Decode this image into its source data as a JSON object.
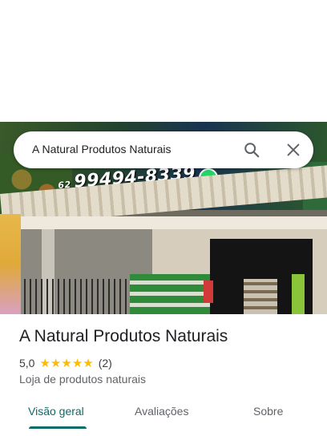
{
  "search": {
    "query": "A Natural Produtos Naturais",
    "search_icon": "search-icon",
    "close_icon": "close-icon"
  },
  "hero": {
    "banner_phone_prefix": "62",
    "banner_phone": "99494-8339"
  },
  "place": {
    "title": "A Natural Produtos Naturais",
    "rating": "5,0",
    "stars": 5,
    "review_count": "(2)",
    "category": "Loja de produtos naturais"
  },
  "tabs": [
    {
      "label": "Visão geral",
      "active": true
    },
    {
      "label": "Avaliações",
      "active": false
    },
    {
      "label": "Sobre",
      "active": false
    }
  ],
  "colors": {
    "accent": "#0b6b68",
    "star": "#fbbc04"
  }
}
